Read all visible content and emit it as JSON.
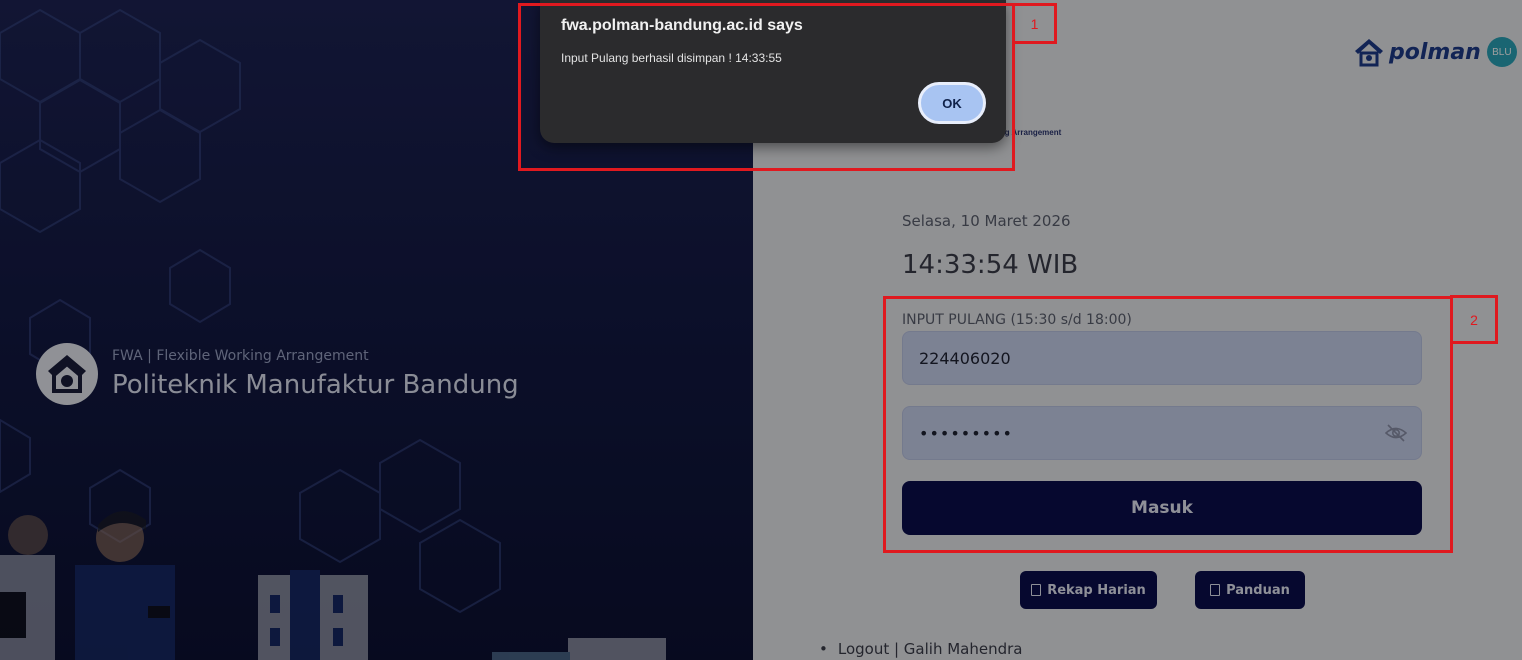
{
  "left_panel": {
    "brand_subtitle": "FWA | Flexible Working Arrangement",
    "brand_title": "Politeknik Manufaktur Bandung"
  },
  "right_panel": {
    "logo_text": "polman",
    "logo_badge": "BLU",
    "fwa_logo_caption": "rking Arrangement",
    "date": "Selasa, 10 Maret 2026",
    "time": "14:33:54 WIB",
    "input_label": "INPUT PULANG (15:30 s/d 18:00)",
    "username_value": "224406020",
    "password_value": "•••••••••",
    "submit_label": "Masuk",
    "rekap_label": "Rekap Harian",
    "panduan_label": "Panduan",
    "logout_text": "Logout | Galih Mahendra"
  },
  "dialog": {
    "title": "fwa.polman-bandung.ac.id says",
    "message": "Input Pulang berhasil disimpan ! 14:33:55",
    "ok_label": "OK"
  },
  "annotations": {
    "box1_label": "1",
    "box2_label": "2",
    "color": "#e0191f"
  }
}
